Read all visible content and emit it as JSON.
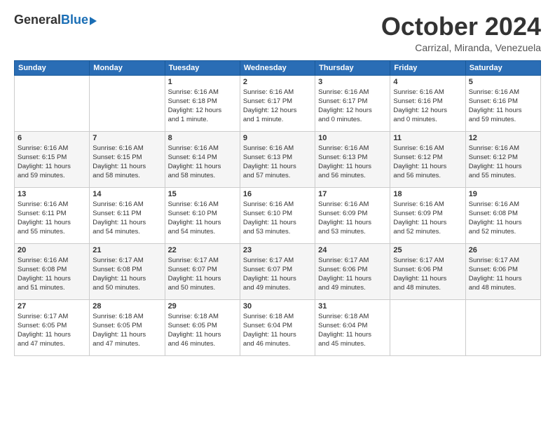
{
  "logo": {
    "general": "General",
    "blue": "Blue"
  },
  "title": "October 2024",
  "location": "Carrizal, Miranda, Venezuela",
  "days_header": [
    "Sunday",
    "Monday",
    "Tuesday",
    "Wednesday",
    "Thursday",
    "Friday",
    "Saturday"
  ],
  "weeks": [
    [
      {
        "day": "",
        "info": ""
      },
      {
        "day": "",
        "info": ""
      },
      {
        "day": "1",
        "info": "Sunrise: 6:16 AM\nSunset: 6:18 PM\nDaylight: 12 hours\nand 1 minute."
      },
      {
        "day": "2",
        "info": "Sunrise: 6:16 AM\nSunset: 6:17 PM\nDaylight: 12 hours\nand 1 minute."
      },
      {
        "day": "3",
        "info": "Sunrise: 6:16 AM\nSunset: 6:17 PM\nDaylight: 12 hours\nand 0 minutes."
      },
      {
        "day": "4",
        "info": "Sunrise: 6:16 AM\nSunset: 6:16 PM\nDaylight: 12 hours\nand 0 minutes."
      },
      {
        "day": "5",
        "info": "Sunrise: 6:16 AM\nSunset: 6:16 PM\nDaylight: 11 hours\nand 59 minutes."
      }
    ],
    [
      {
        "day": "6",
        "info": "Sunrise: 6:16 AM\nSunset: 6:15 PM\nDaylight: 11 hours\nand 59 minutes."
      },
      {
        "day": "7",
        "info": "Sunrise: 6:16 AM\nSunset: 6:15 PM\nDaylight: 11 hours\nand 58 minutes."
      },
      {
        "day": "8",
        "info": "Sunrise: 6:16 AM\nSunset: 6:14 PM\nDaylight: 11 hours\nand 58 minutes."
      },
      {
        "day": "9",
        "info": "Sunrise: 6:16 AM\nSunset: 6:13 PM\nDaylight: 11 hours\nand 57 minutes."
      },
      {
        "day": "10",
        "info": "Sunrise: 6:16 AM\nSunset: 6:13 PM\nDaylight: 11 hours\nand 56 minutes."
      },
      {
        "day": "11",
        "info": "Sunrise: 6:16 AM\nSunset: 6:12 PM\nDaylight: 11 hours\nand 56 minutes."
      },
      {
        "day": "12",
        "info": "Sunrise: 6:16 AM\nSunset: 6:12 PM\nDaylight: 11 hours\nand 55 minutes."
      }
    ],
    [
      {
        "day": "13",
        "info": "Sunrise: 6:16 AM\nSunset: 6:11 PM\nDaylight: 11 hours\nand 55 minutes."
      },
      {
        "day": "14",
        "info": "Sunrise: 6:16 AM\nSunset: 6:11 PM\nDaylight: 11 hours\nand 54 minutes."
      },
      {
        "day": "15",
        "info": "Sunrise: 6:16 AM\nSunset: 6:10 PM\nDaylight: 11 hours\nand 54 minutes."
      },
      {
        "day": "16",
        "info": "Sunrise: 6:16 AM\nSunset: 6:10 PM\nDaylight: 11 hours\nand 53 minutes."
      },
      {
        "day": "17",
        "info": "Sunrise: 6:16 AM\nSunset: 6:09 PM\nDaylight: 11 hours\nand 53 minutes."
      },
      {
        "day": "18",
        "info": "Sunrise: 6:16 AM\nSunset: 6:09 PM\nDaylight: 11 hours\nand 52 minutes."
      },
      {
        "day": "19",
        "info": "Sunrise: 6:16 AM\nSunset: 6:08 PM\nDaylight: 11 hours\nand 52 minutes."
      }
    ],
    [
      {
        "day": "20",
        "info": "Sunrise: 6:16 AM\nSunset: 6:08 PM\nDaylight: 11 hours\nand 51 minutes."
      },
      {
        "day": "21",
        "info": "Sunrise: 6:17 AM\nSunset: 6:08 PM\nDaylight: 11 hours\nand 50 minutes."
      },
      {
        "day": "22",
        "info": "Sunrise: 6:17 AM\nSunset: 6:07 PM\nDaylight: 11 hours\nand 50 minutes."
      },
      {
        "day": "23",
        "info": "Sunrise: 6:17 AM\nSunset: 6:07 PM\nDaylight: 11 hours\nand 49 minutes."
      },
      {
        "day": "24",
        "info": "Sunrise: 6:17 AM\nSunset: 6:06 PM\nDaylight: 11 hours\nand 49 minutes."
      },
      {
        "day": "25",
        "info": "Sunrise: 6:17 AM\nSunset: 6:06 PM\nDaylight: 11 hours\nand 48 minutes."
      },
      {
        "day": "26",
        "info": "Sunrise: 6:17 AM\nSunset: 6:06 PM\nDaylight: 11 hours\nand 48 minutes."
      }
    ],
    [
      {
        "day": "27",
        "info": "Sunrise: 6:17 AM\nSunset: 6:05 PM\nDaylight: 11 hours\nand 47 minutes."
      },
      {
        "day": "28",
        "info": "Sunrise: 6:18 AM\nSunset: 6:05 PM\nDaylight: 11 hours\nand 47 minutes."
      },
      {
        "day": "29",
        "info": "Sunrise: 6:18 AM\nSunset: 6:05 PM\nDaylight: 11 hours\nand 46 minutes."
      },
      {
        "day": "30",
        "info": "Sunrise: 6:18 AM\nSunset: 6:04 PM\nDaylight: 11 hours\nand 46 minutes."
      },
      {
        "day": "31",
        "info": "Sunrise: 6:18 AM\nSunset: 6:04 PM\nDaylight: 11 hours\nand 45 minutes."
      },
      {
        "day": "",
        "info": ""
      },
      {
        "day": "",
        "info": ""
      }
    ]
  ]
}
